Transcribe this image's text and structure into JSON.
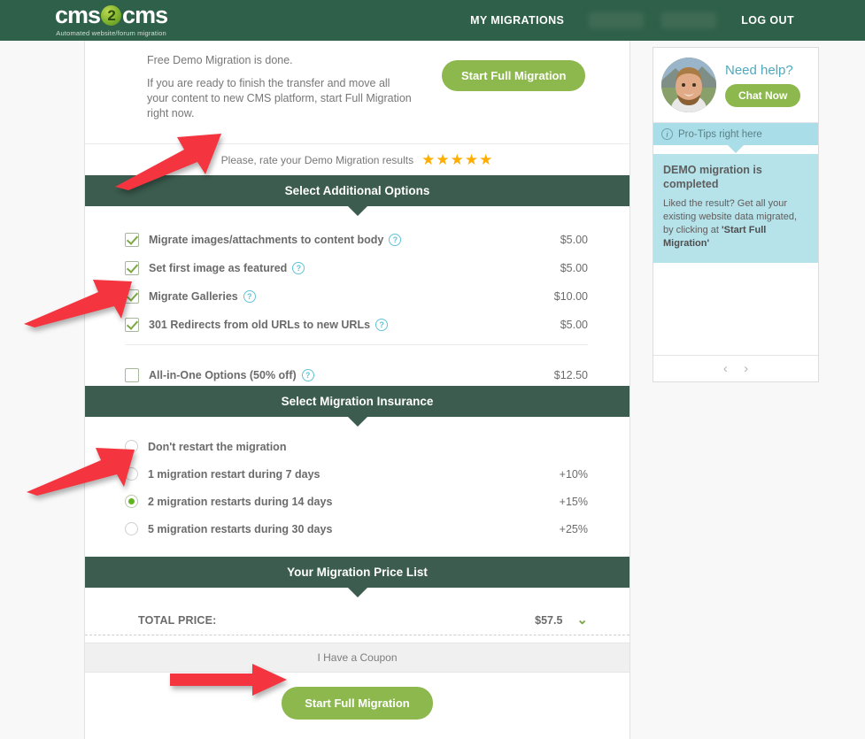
{
  "header": {
    "logo": {
      "left": "cms",
      "badge": "2",
      "right": "cms",
      "tagline": "Automated website/forum migration"
    },
    "nav": {
      "my_migrations": "MY MIGRATIONS",
      "log_out": "LOG OUT"
    },
    "bg_color": "#2f6049"
  },
  "intro": {
    "line1": "Free Demo Migration is done.",
    "line2": "If you are ready to finish the transfer and move all your content to new CMS platform, start Full Migration right now.",
    "button": "Start Full Migration"
  },
  "rating": {
    "label": "Please, rate your Demo Migration results",
    "stars": "★★★★★",
    "value": 5,
    "color": "#ffae00"
  },
  "additional_options": {
    "title": "Select Additional Options",
    "items": [
      {
        "label": "Migrate images/attachments to content body",
        "price": "$5.00",
        "checked": true,
        "help": "?"
      },
      {
        "label": "Set first image as featured",
        "price": "$5.00",
        "checked": true,
        "help": "?"
      },
      {
        "label": "Migrate Galleries",
        "price": "$10.00",
        "checked": true,
        "help": "?"
      },
      {
        "label": "301 Redirects from old URLs to new URLs",
        "price": "$5.00",
        "checked": true,
        "help": "?"
      }
    ],
    "all_in_one": {
      "label": "All-in-One Options (50% off)",
      "price": "$12.50",
      "checked": false,
      "help": "?"
    }
  },
  "insurance": {
    "title": "Select Migration Insurance",
    "items": [
      {
        "label": "Don't restart the migration",
        "price": "",
        "selected": false
      },
      {
        "label": "1 migration restart during 7 days",
        "price": "+10%",
        "selected": false
      },
      {
        "label": "2 migration restarts during 14 days",
        "price": "+15%",
        "selected": true
      },
      {
        "label": "5 migration restarts during 30 days",
        "price": "+25%",
        "selected": false
      }
    ]
  },
  "price_list": {
    "title": "Your Migration Price List",
    "total_label": "TOTAL PRICE:",
    "total_value": "$57.5",
    "expand_icon": "⌄",
    "coupon": "I Have a Coupon",
    "cta": "Start Full Migration"
  },
  "sidebar": {
    "help_title": "Need help?",
    "chat_button": "Chat Now",
    "protips_bar": "Pro-Tips right here",
    "protips_info_icon": "i",
    "tip_title": "DEMO migration is completed",
    "tip_body_1": "Liked the result? Get all your existing website data migrated, by clicking at",
    "tip_body_2": "'Start Full Migration'",
    "prev": "‹",
    "next": "›"
  },
  "annotations": {
    "arrow_color": "#f4353f",
    "count": 4
  }
}
